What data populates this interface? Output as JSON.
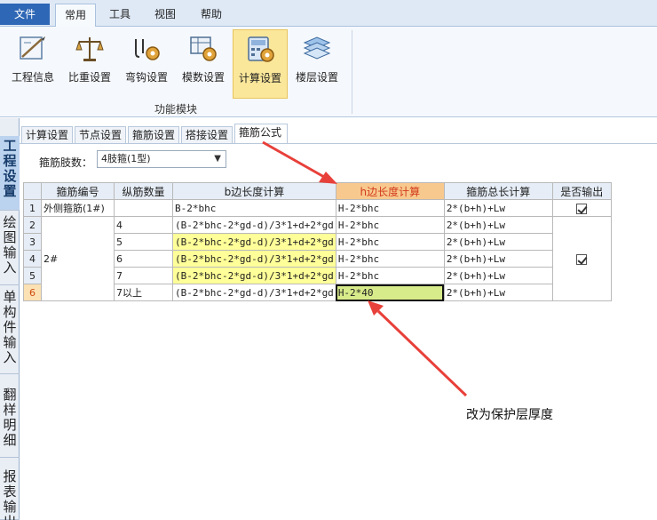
{
  "menu": {
    "file": "文件",
    "tabs": [
      "常用",
      "工具",
      "视图",
      "帮助"
    ]
  },
  "ribbon": {
    "buttons": [
      {
        "label": "工程信息",
        "icon": "project-info-icon"
      },
      {
        "label": "比重设置",
        "icon": "scale-weight-icon"
      },
      {
        "label": "弯钩设置",
        "icon": "hook-gear-icon"
      },
      {
        "label": "模数设置",
        "icon": "modulus-gear-icon"
      },
      {
        "label": "计算设置",
        "icon": "calculator-gear-icon"
      },
      {
        "label": "楼层设置",
        "icon": "floor-stack-icon"
      }
    ],
    "group_label": "功能模块"
  },
  "left_tabs": [
    "工程设置",
    "绘图输入",
    "单构件输入",
    "翻样明细",
    "报表输出"
  ],
  "sub_tabs": [
    "计算设置",
    "节点设置",
    "箍筋设置",
    "搭接设置",
    "箍筋公式"
  ],
  "leg": {
    "label": "箍筋肢数：",
    "value": "4肢箍(1型)"
  },
  "table": {
    "headers": [
      "箍筋编号",
      "纵筋数量",
      "b边长度计算",
      "h边长度计算",
      "箍筋总长计算",
      "是否输出"
    ],
    "rows": [
      {
        "n": "1",
        "id": "外侧箍筋(1#)",
        "count": "",
        "b": "B-2*bhc",
        "h": "H-2*bhc",
        "total": "2*(b+h)+Lw"
      },
      {
        "n": "2",
        "id": "2#",
        "count": "4",
        "b": "(B-2*bhc-2*gd-d)/3*1+d+2*gd",
        "h": "H-2*bhc",
        "total": "2*(b+h)+Lw"
      },
      {
        "n": "3",
        "id": "",
        "count": "5",
        "b": "(B-2*bhc-2*gd-d)/3*1+d+2*gd",
        "h": "H-2*bhc",
        "total": "2*(b+h)+Lw"
      },
      {
        "n": "4",
        "id": "",
        "count": "6",
        "b": "(B-2*bhc-2*gd-d)/3*1+d+2*gd",
        "h": "H-2*bhc",
        "total": "2*(b+h)+Lw"
      },
      {
        "n": "5",
        "id": "",
        "count": "7",
        "b": "(B-2*bhc-2*gd-d)/3*1+d+2*gd",
        "h": "H-2*bhc",
        "total": "2*(b+h)+Lw"
      },
      {
        "n": "6",
        "id": "",
        "count": "7以上",
        "b": "(B-2*bhc-2*gd-d)/3*1+d+2*gd",
        "h": "H-2*40",
        "total": "2*(b+h)+Lw"
      }
    ]
  },
  "annotation": "改为保护层厚度",
  "colors": {
    "file_tab": "#2e67b5",
    "selected_button": "#fbe79a",
    "yellow_cell": "#ffff99",
    "edited_cell": "#d8eb8a",
    "highlight_header": "#f8c98e",
    "arrow": "#e8403a"
  }
}
